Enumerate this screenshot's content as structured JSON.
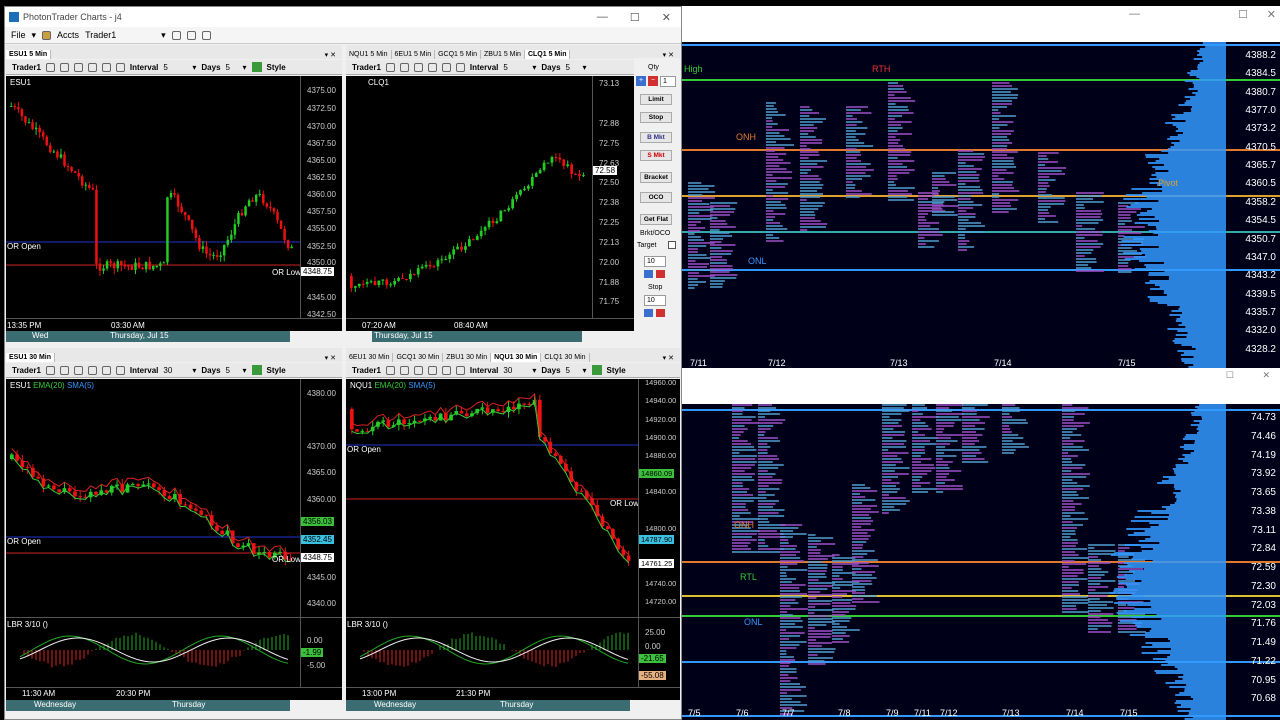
{
  "window": {
    "title": "PhotonTrader Charts - j4",
    "controls": [
      "—",
      "☐",
      "✕"
    ]
  },
  "menubar": {
    "file": "File",
    "accts": "Accts",
    "account": "Trader1"
  },
  "pane1": {
    "tabs": [
      "ESU1 5 Min"
    ],
    "toolbar": {
      "account": "Trader1",
      "interval_label": "Interval",
      "interval": "5",
      "days_label": "Days",
      "days": "5",
      "style": "Style"
    },
    "symbol": "ESU1",
    "axis": [
      "4375.00",
      "4372.50",
      "4370.00",
      "4367.50",
      "4365.00",
      "4362.50",
      "4360.00",
      "4357.50",
      "4355.00",
      "4352.50",
      "4350.00",
      "4347.50",
      "4345.00",
      "4342.50"
    ],
    "price_tag": "4348.75",
    "or_open": "OR Open",
    "or_low": "OR Low",
    "times": [
      "13:35 PM",
      "03:30 AM"
    ],
    "days_bar": [
      "Wed",
      "Thursday, Jul 15"
    ]
  },
  "pane2": {
    "tabs": [
      "NQU1 5 Min",
      "6EU1 5 Min",
      "GCQ1 5 Min",
      "ZBU1 5 Min",
      "CLQ1 5 Min"
    ],
    "toolbar": {
      "account": "Trader1",
      "interval_label": "Interval",
      "interval": "5",
      "days_label": "Days",
      "days": "5"
    },
    "symbol": "CLQ1",
    "axis": [
      "73.13",
      "72.88",
      "72.75",
      "72.63",
      "72.50",
      "72.38",
      "72.25",
      "72.13",
      "72.00",
      "71.88",
      "71.75"
    ],
    "price_tag": "72.58",
    "times": [
      "07:20 AM",
      "08:40 AM"
    ],
    "days_bar": "Thursday, Jul 15"
  },
  "order_panel": {
    "qty_label": "Qty",
    "qty": "1",
    "limit": "Limit",
    "stop": "Stop",
    "bmkt": "B Mkt",
    "smkt": "S Mkt",
    "bracket": "Bracket",
    "oco": "OCO",
    "getflat": "Get Flat",
    "brkt_oco": "Brkt/OCO",
    "target_label": "Target",
    "target": "10",
    "stop_label": "Stop",
    "stop_val": "10"
  },
  "pane3": {
    "tabs": [
      "ESU1 30 Min"
    ],
    "toolbar": {
      "account": "Trader1",
      "interval_label": "Interval",
      "interval": "30",
      "days_label": "Days",
      "days": "5",
      "style": "Style"
    },
    "symbol": "ESU1",
    "ema": "EMA(20)",
    "sma": "SMA(5)",
    "axis": [
      "4380.00",
      "4375.00",
      "4370.00",
      "4365.00",
      "4360.00",
      "4355.00",
      "4350.00",
      "4345.00",
      "4340.00"
    ],
    "tags": [
      "4356.03",
      "4352.45",
      "4348.75"
    ],
    "or_open": "OR Open",
    "or_low": "OR Low",
    "indicator": "LBR 3/10 ()",
    "ind_axis": [
      "0.00",
      "-1.99",
      "-5.00"
    ],
    "times": [
      "11:30 AM",
      "20:30 PM"
    ],
    "days_bar": [
      "Wednesday",
      "Thursday"
    ]
  },
  "pane4": {
    "tabs": [
      "6EU1 30 Min",
      "GCQ1 30 Min",
      "ZBU1 30 Min",
      "NQU1 30 Min",
      "CLQ1 30 Min"
    ],
    "toolbar": {
      "account": "Trader1",
      "interval_label": "Interval",
      "interval": "30",
      "days_label": "Days",
      "days": "5",
      "style": "Style"
    },
    "symbol": "NQU1",
    "ema": "EMA(20)",
    "sma": "SMA(5)",
    "axis": [
      "14960.00",
      "14940.00",
      "14920.00",
      "14900.00",
      "14880.00",
      "14860.00",
      "14840.00",
      "14820.00",
      "14800.00",
      "14780.00",
      "14760.00",
      "14740.00",
      "14720.00"
    ],
    "tags": [
      "14860.09",
      "14787.90",
      "14761.25"
    ],
    "or_open": "OR Open",
    "or_low": "OR Low",
    "indicator": "LBR 3/10 ()",
    "ind_axis": [
      "25.00",
      "0.00",
      "-21.65",
      "-55.08"
    ],
    "times": [
      "13:00 PM",
      "21:30 PM"
    ],
    "days_bar": [
      "Wednesday",
      "Thursday"
    ]
  },
  "mp_top": {
    "controls": [
      "—",
      "☐",
      "✕"
    ],
    "labels": {
      "high": "High",
      "rth": "RTH",
      "onh": "ONH",
      "pivot": "Pivot",
      "onl": "ONL"
    },
    "axis": [
      "4388.2",
      "4384.5",
      "4380.7",
      "4377.0",
      "4373.2",
      "4370.5",
      "4365.7",
      "4360.5",
      "4358.2",
      "4354.5",
      "4350.7",
      "4347.0",
      "4343.2",
      "4339.5",
      "4335.7",
      "4332.0",
      "4328.2"
    ],
    "dates": [
      "7/11",
      "7/12",
      "7/13",
      "7/14",
      "7/15"
    ]
  },
  "mp_bottom": {
    "controls": [
      "—",
      "☐",
      "✕"
    ],
    "labels": {
      "onh": "ONH",
      "rtl": "RTL",
      "onl": "ONL"
    },
    "axis": [
      "74.73",
      "74.46",
      "74.19",
      "73.92",
      "73.65",
      "73.38",
      "73.11",
      "72.84",
      "72.59",
      "72.30",
      "72.03",
      "71.76",
      "71.49",
      "71.22",
      "70.95",
      "70.68"
    ],
    "dates": [
      "7/5",
      "7/6",
      "7/7",
      "7/8",
      "7/9",
      "7/11",
      "7/12",
      "7/13",
      "7/14",
      "7/15"
    ]
  },
  "colors": {
    "up": "#22cc22",
    "down": "#ee1111",
    "or_open": "#2233cc",
    "or_low": "#cc2222",
    "profile": "#3399ff",
    "onh": "#e07a2a",
    "pivot": "#e0a030"
  }
}
